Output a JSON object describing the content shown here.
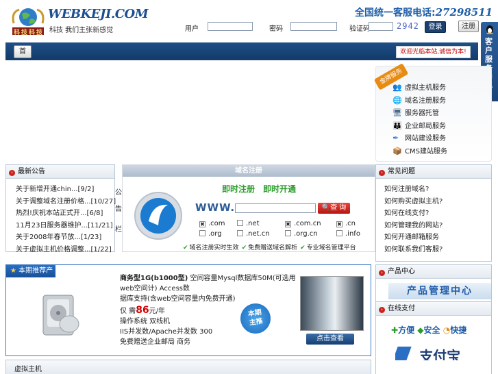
{
  "header": {
    "logo_text": "WEBKEJI.COM",
    "logo_cn": "科技科技",
    "tagline": "科技  我们主张新感觉",
    "hotline_label": "全国统一客服电话:",
    "hotline_number": "27298511",
    "login": {
      "user_label": "用户",
      "pass_label": "密码",
      "code_label": "验证码",
      "code_value": "2942",
      "login_button": "登录",
      "register_button": "注册"
    }
  },
  "navbar": {
    "home_button": "首",
    "notice": "欢迎光临本站,诚信为本!"
  },
  "side_float": {
    "label": "客户服务中心",
    "arrow": "«"
  },
  "gold_service": {
    "badge": "金牌服务",
    "items": [
      {
        "label": "虚拟主机服务",
        "icon": "users-icon"
      },
      {
        "label": "域名注册服务",
        "icon": "globe-icon"
      },
      {
        "label": "服务器托管",
        "icon": "server-icon"
      },
      {
        "label": "企业邮局服务",
        "icon": "people-icon"
      },
      {
        "label": "网站建设服务",
        "icon": "pen-icon"
      },
      {
        "label": "CMS建站服务",
        "icon": "box-icon"
      }
    ]
  },
  "news": {
    "title": "最新公告",
    "items": [
      "关于新增开通chin...[9/2]",
      "关于调整域名注册价格...[10/27]",
      "热烈!庆祝本站正式开...[6/8]",
      "11月23日服务器维护...[11/21]",
      "关于2008年春节放...[1/23]",
      "关于虚拟主机价格调整...[1/22]"
    ],
    "side_marks": [
      "公",
      "告",
      "栏"
    ]
  },
  "domain": {
    "title": "域名注册",
    "slogan1": "即时注册",
    "slogan2": "即时开通",
    "www": "WWW.",
    "input_value": "",
    "search_button": "查 询",
    "tlds": [
      {
        "label": ".com",
        "checked": true
      },
      {
        "label": ".net",
        "checked": false
      },
      {
        "label": ".com.cn",
        "checked": true
      },
      {
        "label": ".cn",
        "checked": true
      },
      {
        "label": ".org",
        "checked": false
      },
      {
        "label": ".net.cn",
        "checked": false
      },
      {
        "label": ".org.cn",
        "checked": false
      },
      {
        "label": ".info",
        "checked": false
      }
    ],
    "features": [
      "域名注册实时生效",
      "免费赠送域名解析",
      "专业域名管理平台"
    ]
  },
  "faq": {
    "title": "常见问题",
    "items": [
      "如何注册域名?",
      "如何购买虚拟主机?",
      "如何在线支付?",
      "如何管理我的网站?",
      "如何开通邮箱服务",
      "如何联系我们客服?"
    ]
  },
  "recommend": {
    "title": "本期推荐产品",
    "line1_bold": "商务型1G(b1000型)",
    "line1_rest": " 空间容量Mysql数据库50M(可选用web空间计) Access数",
    "line2": "据库支持(含web空间容量内免费开通)",
    "price_prefix": "仅 需",
    "price": "86",
    "price_unit": "元/年",
    "line4": "操作系统 双线机",
    "line5": "IIS并发数/Apache并发数 300",
    "line6": "免费赠送企业邮局 商务",
    "badge_line1": "本期",
    "badge_line2": "主推",
    "view_button": "点击查看"
  },
  "product_center": {
    "title": "产品中心",
    "banner": "产品管理中心"
  },
  "payment": {
    "title": "在线支付",
    "banner_words": [
      "方便",
      "安全",
      "快捷"
    ],
    "logo_text": "支付宝"
  },
  "hosting": {
    "title": "虚拟主机"
  }
}
